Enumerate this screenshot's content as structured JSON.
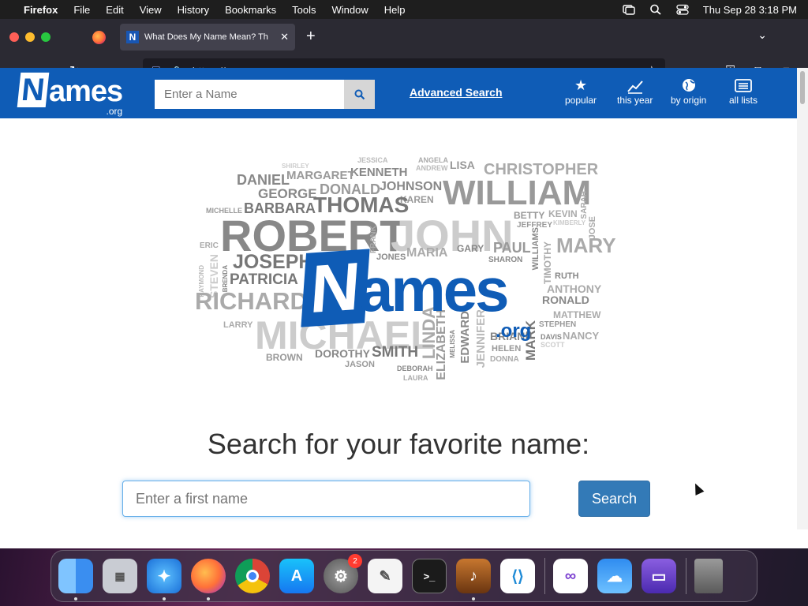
{
  "menubar": {
    "app": "Firefox",
    "items": [
      "File",
      "Edit",
      "View",
      "History",
      "Bookmarks",
      "Tools",
      "Window",
      "Help"
    ],
    "datetime": "Thu Sep 28  3:18 PM"
  },
  "browser": {
    "tab_title": "What Does My Name Mean? Th",
    "favicon_letter": "N",
    "url_prefix": "https://www.",
    "url_domain": "names.org"
  },
  "site": {
    "logo_letter": "N",
    "logo_rest": "ames",
    "logo_org": ".org",
    "header_search_placeholder": "Enter a Name",
    "advanced_search": "Advanced Search",
    "nav": [
      {
        "label": "popular",
        "icon": "star-icon",
        "glyph": "★"
      },
      {
        "label": "this year",
        "icon": "chart-icon",
        "glyph": "📈"
      },
      {
        "label": "by origin",
        "icon": "globe-icon",
        "glyph": "🌍"
      },
      {
        "label": "all lists",
        "icon": "list-icon",
        "glyph": "☰"
      }
    ],
    "headline": "Search for your favorite name:",
    "main_search_placeholder": "Enter a first name",
    "search_button": "Search"
  },
  "word_cloud": [
    "SHIRLEY",
    "JESSICA",
    "ANGELA",
    "LISA",
    "KENNETH",
    "ANDREW",
    "CHRISTOPHER",
    "DANIEL",
    "MARGARET",
    "GEORGE",
    "DONALD",
    "JOHNSON",
    "WILLIAM",
    "KAREN",
    "BARBARA",
    "THOMAS",
    "MICHELLE",
    "SARAH",
    "BETTY",
    "KEVIN",
    "KIMBERLY",
    "ROBERT",
    "JOHN",
    "JEFFREY",
    "JOSE",
    "ERIC",
    "FRANK",
    "JOSEPH",
    "MARY",
    "GARY",
    "PAUL",
    "JONES",
    "MARIA",
    "WILLIAMS",
    "STEVEN",
    "SHARON",
    "TIMOTHY",
    "RAYMOND",
    "PATRICIA",
    "BRENDA",
    "RUTH",
    "ANTHONY",
    "RICHARD",
    "RONALD",
    "MATTHEW",
    "LARRY",
    "STEPHEN",
    "MICHAEL",
    "LINDA",
    "NANCY",
    "DAVIS",
    "MELISSA",
    "EDWARD",
    "JENNIFER",
    "BRIAN",
    "SCOTT",
    "ELIZABETH",
    "HELEN",
    "DOROTHY",
    "SMITH",
    "DONNA",
    "BROWN",
    "MARK",
    "JASON",
    "DEBORAH",
    "LAURA"
  ],
  "dock": {
    "settings_badge": "2",
    "apps": [
      "Finder",
      "Launchpad",
      "Safari",
      "Firefox",
      "Chrome",
      "App Store",
      "System Settings",
      "TextEdit",
      "Terminal",
      "GarageBand",
      "VS Code",
      "Visual Studio",
      "Weather",
      "Simulator",
      "Trash"
    ]
  },
  "colors": {
    "brand_blue": "#0f5cb6",
    "button_blue": "#337ab7"
  }
}
